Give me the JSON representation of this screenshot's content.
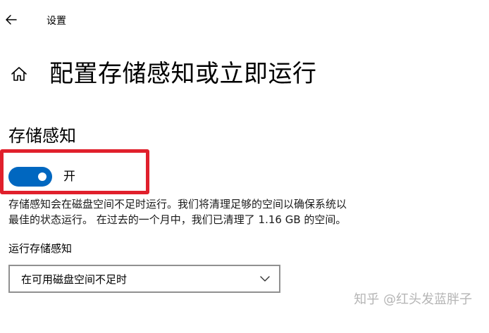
{
  "header": {
    "back_icon": "arrow-left-icon",
    "app_title": "设置"
  },
  "page": {
    "home_icon": "home-icon",
    "title": "配置存储感知或立即运行"
  },
  "storage_sense": {
    "section_title": "存储感知",
    "toggle_state": true,
    "toggle_label": "开",
    "accent_color": "#0067c0",
    "highlight_color": "#e0202c",
    "description_line1": "存储感知会在磁盘空间不足时运行。我们将清理足够的空间以确保系统以",
    "description_line2": "最佳的状态运行。 在过去的一个月中，我们已清理了 1.16 GB 的空间。"
  },
  "run_setting": {
    "label": "运行存储感知",
    "selected": "在可用磁盘空间不足时",
    "chevron_icon": "chevron-down-icon"
  },
  "watermark": "知乎 @红头发蓝胖子"
}
